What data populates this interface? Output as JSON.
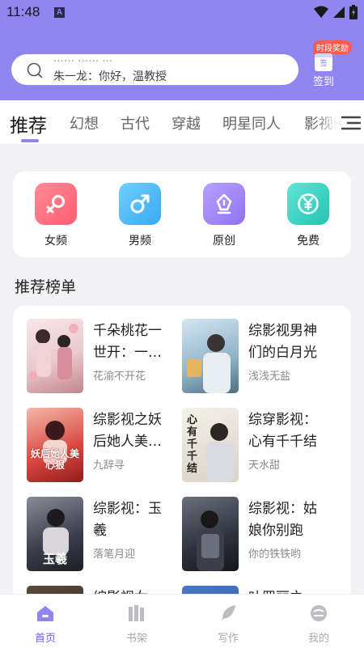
{
  "status_bar": {
    "time": "11:48",
    "notif_icon": "A"
  },
  "search": {
    "text": "朱一龙：你好，温教授",
    "ghost_text": "…… …… …"
  },
  "signin": {
    "badge": "时段奖励",
    "icon_text": "签",
    "label": "签到"
  },
  "tabs": [
    {
      "label": "推荐",
      "active": true
    },
    {
      "label": "幻想",
      "active": false
    },
    {
      "label": "古代",
      "active": false
    },
    {
      "label": "穿越",
      "active": false
    },
    {
      "label": "明星同人",
      "active": false
    },
    {
      "label": "影视同人",
      "active": false
    }
  ],
  "categories": [
    {
      "label": "女频",
      "icon": "female-icon",
      "color": "#ff6b7a"
    },
    {
      "label": "男频",
      "icon": "male-icon",
      "color": "#4fb8f8"
    },
    {
      "label": "原创",
      "icon": "pen-icon",
      "color": "#a58af5"
    },
    {
      "label": "免费",
      "icon": "yen-icon",
      "color": "#3fd4c6"
    }
  ],
  "section_title": "推荐榜单",
  "books": [
    {
      "title": "千朵桃花一世开：一…",
      "author": "花渝不开花"
    },
    {
      "title": "综影视男神们的白月光",
      "author": "浅浅无盐"
    },
    {
      "title": "综影视之妖后她人美…",
      "author": "九辞寻"
    },
    {
      "title": "综穿影视：心有千千结",
      "author": "天水甜"
    },
    {
      "title": "综影视：玉羲",
      "author": "落笔月迎"
    },
    {
      "title": "综影视：姑娘你别跑",
      "author": "你的铁铁哟"
    },
    {
      "title": "综影视女…",
      "author": ""
    },
    {
      "title": "叶罗丽之…",
      "author": ""
    }
  ],
  "cover_texts": [
    "妖后她人美心狠",
    "心有千千结",
    "玉羲"
  ],
  "bottom_nav": [
    {
      "label": "首页",
      "icon": "home-icon",
      "active": true
    },
    {
      "label": "书架",
      "icon": "bookshelf-icon",
      "active": false
    },
    {
      "label": "写作",
      "icon": "feather-icon",
      "active": false
    },
    {
      "label": "我的",
      "icon": "profile-icon",
      "active": false
    }
  ],
  "colors": {
    "accent": "#8f86f0",
    "active_nav": "#6f63e8",
    "badge": "#ff5a4f"
  }
}
